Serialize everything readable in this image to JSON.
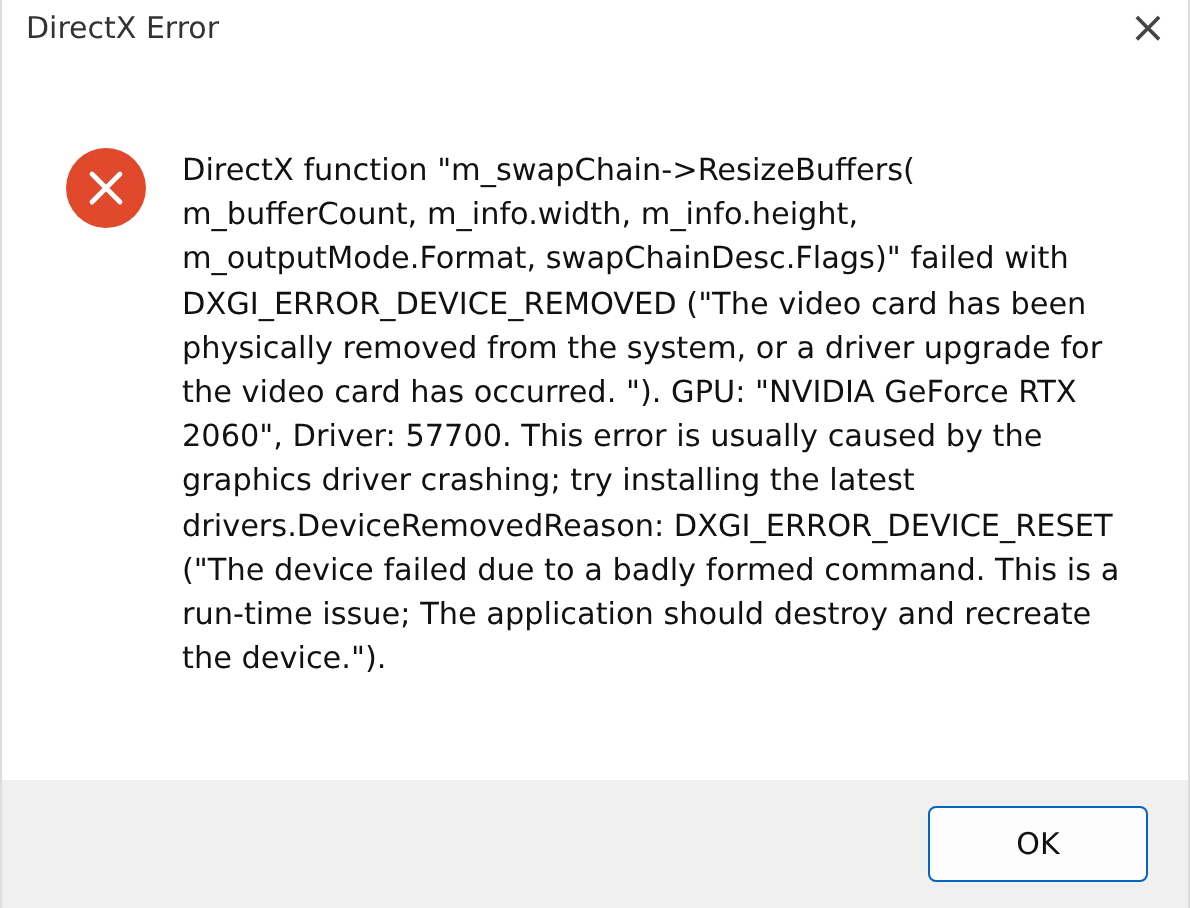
{
  "window": {
    "title": "DirectX Error",
    "close": "×"
  },
  "message": "DirectX function \"m_swapChain->ResizeBuffers( m_bufferCount, m_info.width, m_info.height, m_outputMode.Format, swapChainDesc.Flags)\" failed with DXGI_ERROR_DEVICE_REMOVED (\"The video card has been physically removed from the system, or a driver upgrade for the video card has occurred. \"). GPU: \"NVIDIA GeForce RTX 2060\", Driver: 57700. This error is usually caused by the graphics driver crashing; try installing the latest drivers.DeviceRemovedReason: DXGI_ERROR_DEVICE_RESET (\"The device failed due to a badly formed command. This is a run-time issue; The application should destroy and recreate the device.\").",
  "buttons": [
    {
      "label": "OK"
    }
  ]
}
